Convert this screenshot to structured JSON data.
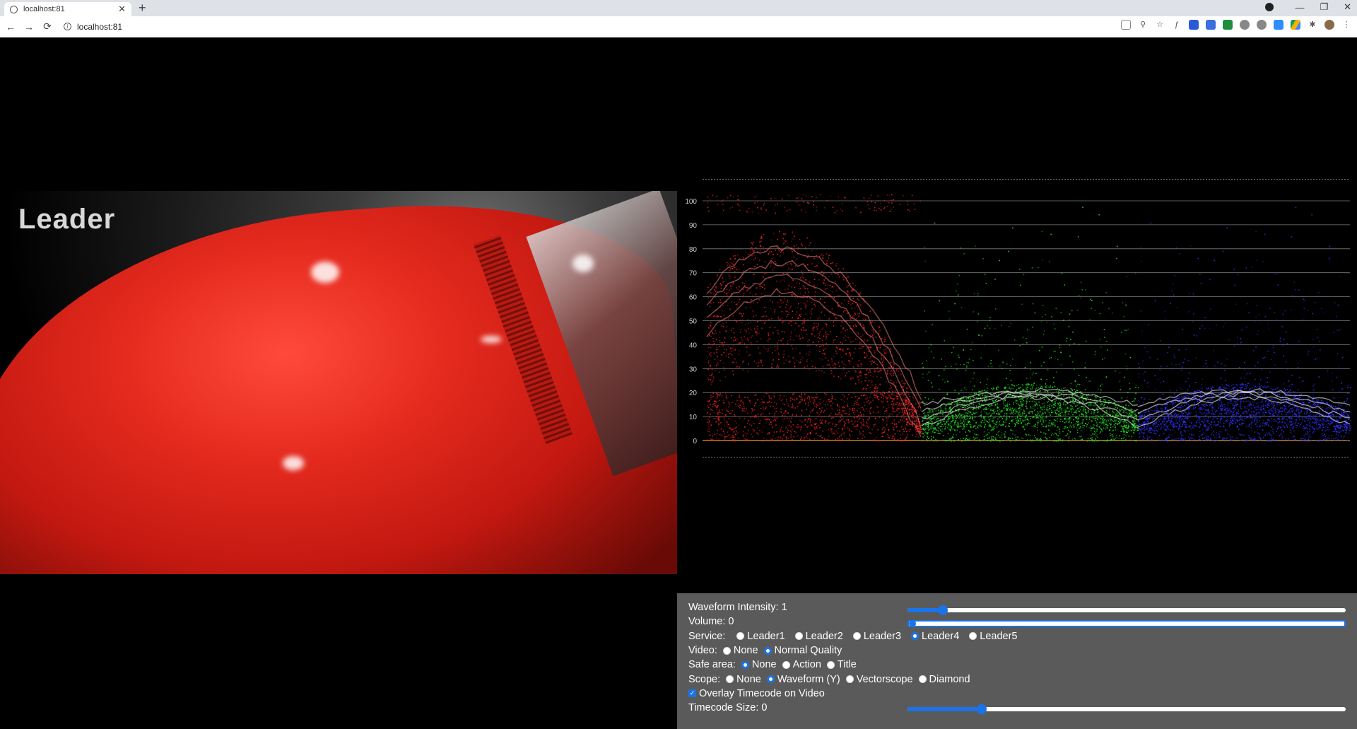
{
  "browser": {
    "tab_title": "localhost:81",
    "tab_close": "✕",
    "new_tab": "+",
    "url": "localhost:81",
    "back": "←",
    "forward": "→",
    "reload": "⟳",
    "minimize": "—",
    "restore": "❐",
    "close": "✕"
  },
  "video": {
    "logo_text": "Leader"
  },
  "scope": {
    "ticks": [
      "100",
      "90",
      "80",
      "70",
      "60",
      "50",
      "40",
      "30",
      "20",
      "10",
      "0"
    ],
    "colors": {
      "red": "#ff2020",
      "green": "#20e020",
      "blue": "#3030ff",
      "grid": "#7a7a7a",
      "zero_line": "#c08020"
    }
  },
  "controls": {
    "waveform_intensity_label": "Waveform Intensity: 1",
    "waveform_intensity_value": 0.08,
    "volume_label": "Volume: 0",
    "volume_value": 0.0,
    "service_label": "Service:",
    "service_options": [
      "Leader1",
      "Leader2",
      "Leader3",
      "Leader4",
      "Leader5"
    ],
    "service_selected": "Leader4",
    "video_label": "Video:",
    "video_options": [
      "None",
      "Normal Quality"
    ],
    "video_selected": "Normal Quality",
    "safe_area_label": "Safe area:",
    "safe_area_options": [
      "None",
      "Action",
      "Title"
    ],
    "safe_area_selected": "None",
    "scope_label": "Scope:",
    "scope_options": [
      "None",
      "Waveform (Y)",
      "Vectorscope",
      "Diamond"
    ],
    "scope_selected": "Waveform (Y)",
    "overlay_timecode_label": "Overlay Timecode on Video",
    "overlay_timecode_checked": true,
    "timecode_size_label": "Timecode Size: 0",
    "timecode_size_value": 0.17
  }
}
